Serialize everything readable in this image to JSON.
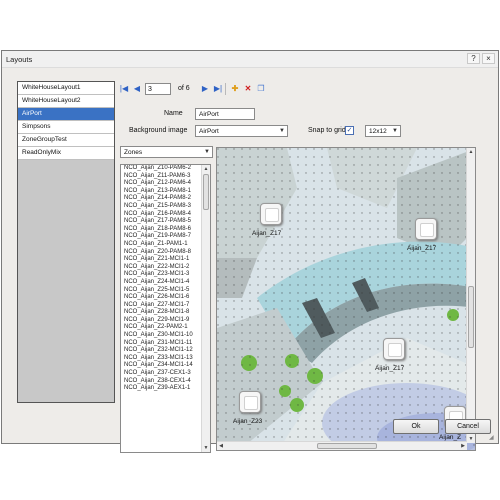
{
  "window": {
    "title": "Layouts",
    "controls": [
      "?",
      "×"
    ]
  },
  "layouts": [
    "WhiteHouseLayout1",
    "WhiteHouseLayout2",
    "AirPort",
    "Simpsons",
    "ZoneGroupTest",
    "ReadOnlyMix"
  ],
  "selected_layout_index": 2,
  "navigator": {
    "page": "3",
    "of_label": "of 6"
  },
  "form": {
    "name_label": "Name",
    "name_value": "AirPort",
    "background_label": "Background image",
    "background_value": "AirPort",
    "snap_label": "Snap to grid",
    "snap_checked": true,
    "grid_value": "12x12"
  },
  "zones_dropdown": "Zones",
  "zones": [
    "NCO_Aijan_Z10-PAM6-2",
    "NCO_Aijan_Z11-PAM6-3",
    "NCO_Aijan_Z12-PAM6-4",
    "NCO_Aijan_Z13-PAM8-1",
    "NCO_Aijan_Z14-PAM8-2",
    "NCO_Aijan_Z15-PAM8-3",
    "NCO_Aijan_Z16-PAM8-4",
    "NCO_Aijan_Z17-PAM8-5",
    "NCO_Aijan_Z18-PAM8-6",
    "NCO_Aijan_Z19-PAM8-7",
    "NCO_Aijan_Z1-PAM1-1",
    "NCO_Aijan_Z20-PAM8-8",
    "NCO_Aijan_Z21-MCI1-1",
    "NCO_Aijan_Z22-MCI1-2",
    "NCO_Aijan_Z23-MCI1-3",
    "NCO_Aijan_Z24-MCI1-4",
    "NCO_Aijan_Z25-MCI1-5",
    "NCO_Aijan_Z26-MCI1-6",
    "NCO_Aijan_Z27-MCI1-7",
    "NCO_Aijan_Z28-MCI1-8",
    "NCO_Aijan_Z29-MCI1-9",
    "NCO_Aijan_Z2-PAM2-1",
    "NCO_Aijan_Z30-MCI1-10",
    "NCO_Aijan_Z31-MCI1-11",
    "NCO_Aijan_Z32-MCI1-12",
    "NCO_Aijan_Z33-MCI1-13",
    "NCO_Aijan_Z34-MCI1-14",
    "NCO_Aijan_Z37-CEX1-3",
    "NCO_Aijan_Z38-CEX1-4",
    "NCO_Aijan_Z39-AEX1-1"
  ],
  "map_zones": [
    {
      "label": "Aijan_Z17"
    },
    {
      "label": "Aijan_Z17"
    },
    {
      "label": "Aijan_Z17"
    },
    {
      "label": "Aijan_Z23"
    },
    {
      "label": "Aijan_Z"
    }
  ],
  "buttons": {
    "ok": "Ok",
    "cancel": "Cancel"
  },
  "colors": {
    "selection": "#3a72c4",
    "nav_icons": "#2f62c5",
    "add_icon": "#e0a020",
    "delete_icon": "#d02020"
  }
}
